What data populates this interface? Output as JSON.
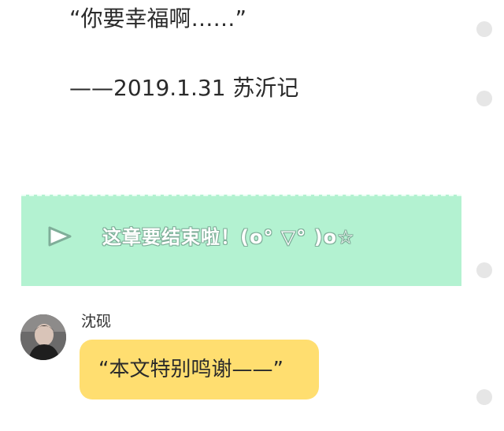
{
  "story": {
    "quote_line": "“你要幸福啊……”",
    "signature_line": "——2019.1.31 苏沂记"
  },
  "banner": {
    "text": "这章要结束啦！(o° ▽° )o☆",
    "icon": "play-icon",
    "background_color": "#b3f2d1"
  },
  "comment": {
    "author": "沈砚",
    "message": "“本文特别鸣谢——”",
    "bubble_color": "#ffde70"
  },
  "side_markers": {
    "icon": "dot-icon",
    "color": "#e6e6e6"
  }
}
